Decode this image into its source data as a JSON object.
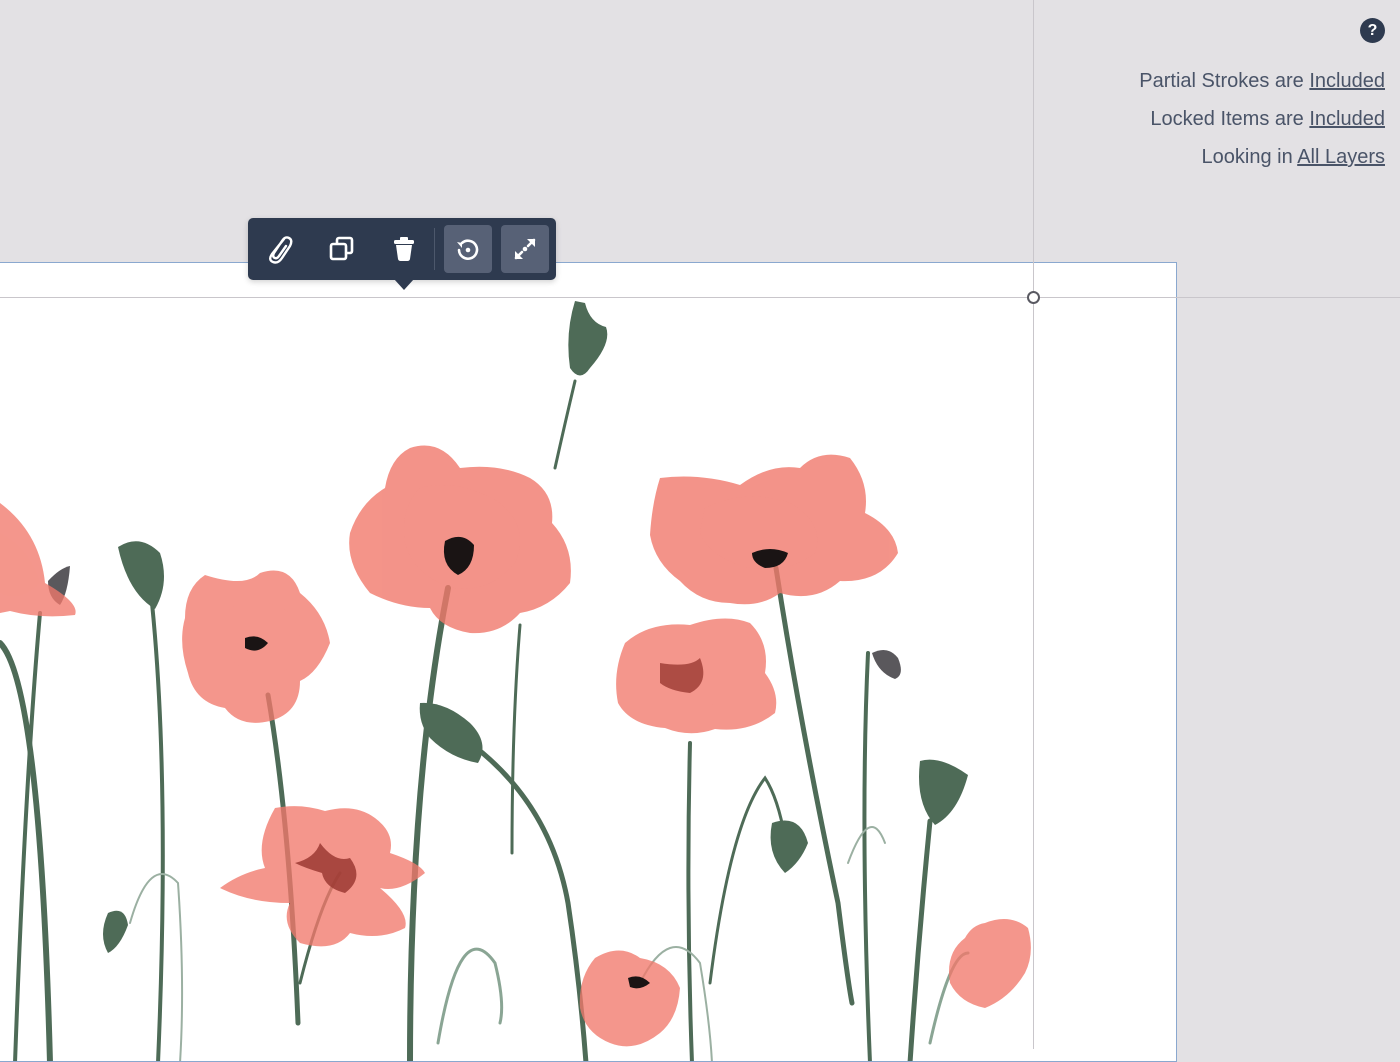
{
  "help": {
    "label": "?"
  },
  "selection_options": {
    "partial_strokes": {
      "text": "Partial Strokes are",
      "value": "Included"
    },
    "locked_items": {
      "text": "Locked Items are",
      "value": "Included"
    },
    "layers": {
      "text": "Looking in",
      "value": "All Layers"
    }
  },
  "toolbar": {
    "buttons": [
      {
        "icon": "paperclip-icon",
        "action": "attach"
      },
      {
        "icon": "duplicate-icon",
        "action": "duplicate"
      },
      {
        "icon": "trash-icon",
        "action": "delete"
      },
      {
        "icon": "rotate-icon",
        "action": "rotate",
        "active": true
      },
      {
        "icon": "scale-icon",
        "action": "scale",
        "active": true
      }
    ]
  },
  "colors": {
    "canvas_background": "#e3e1e4",
    "toolbar": "#2e3a4f",
    "toolbar_active": "#576176",
    "selection_border": "#8aa8cf",
    "poppy_petal": "#f1796c",
    "poppy_center": "#1a1414",
    "stem": "#4e6b57",
    "text": "#4a5468"
  }
}
